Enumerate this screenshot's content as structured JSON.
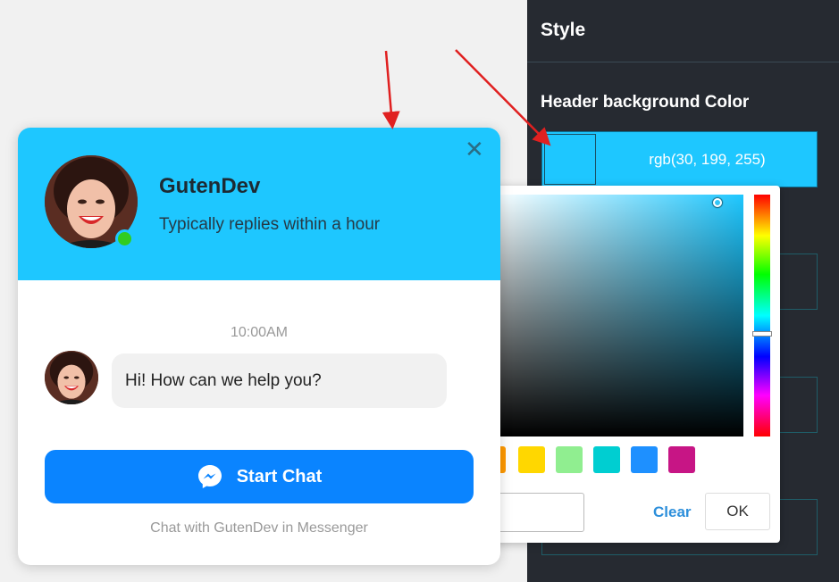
{
  "style_panel": {
    "title": "Style",
    "header_bg_label": "Header background Color",
    "header_bg_value": "rgb(30, 199, 255)",
    "header_bg_color": "#1ec7ff"
  },
  "color_picker": {
    "preset_colors": [
      "#ff9900",
      "#ffd700",
      "#90ee90",
      "#00ced1",
      "#1e90ff",
      "#c71585"
    ],
    "clear_label": "Clear",
    "ok_label": "OK"
  },
  "chat_widget": {
    "agent_name": "GutenDev",
    "reply_time": "Typically replies within a hour",
    "timestamp": "10:00AM",
    "message": "Hi! How can we help you?",
    "start_chat_label": "Start Chat",
    "footer_note": "Chat with GutenDev in Messenger",
    "close_icon": "close-icon",
    "messenger_icon": "messenger-icon",
    "button_color": "#0a84ff",
    "online_color": "#31cc1f"
  },
  "annotations": {
    "arrow_color": "#e02020"
  }
}
